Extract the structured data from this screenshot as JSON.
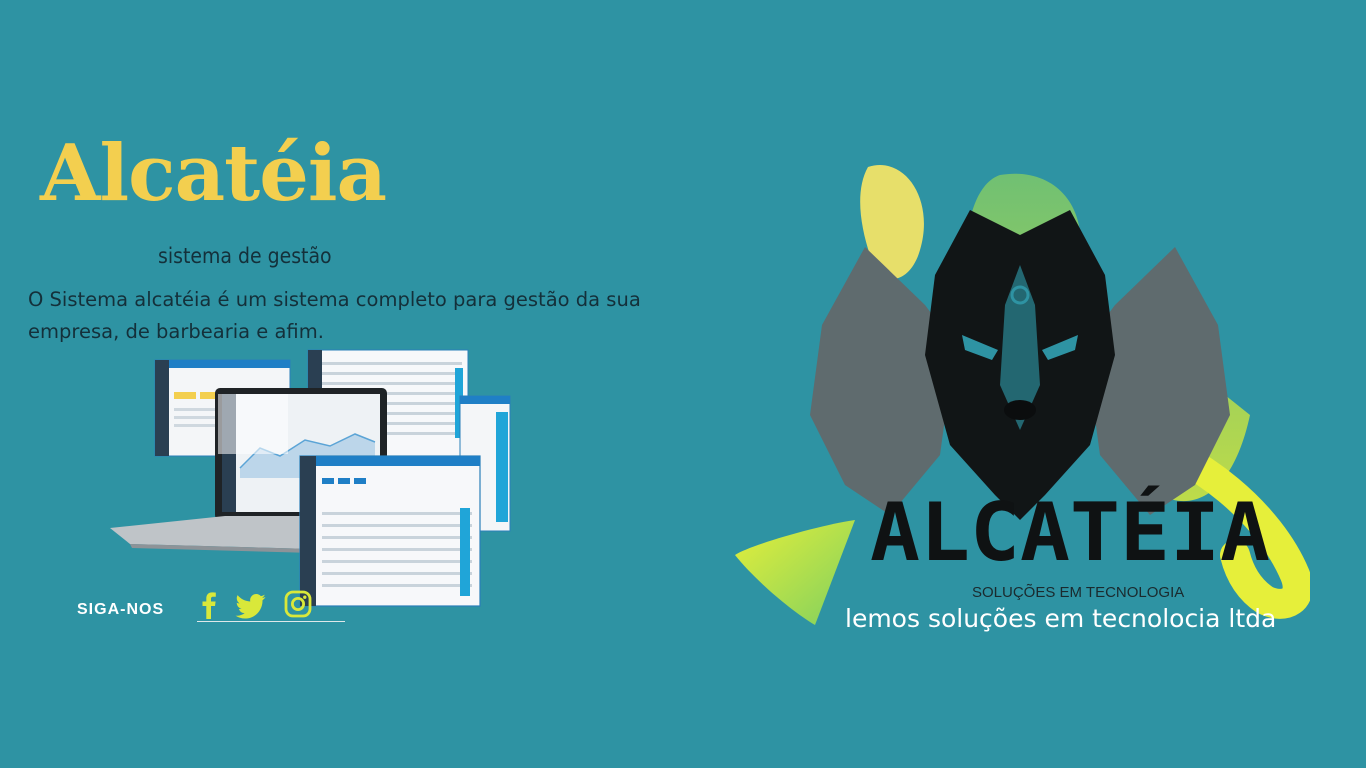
{
  "hero": {
    "title": "Alcatéia",
    "subtitle": "sistema de gestão",
    "description": "O Sistema alcatéia é um sistema completo para gestão da sua empresa,  de barbearia e afim."
  },
  "social": {
    "label": "SIGA-NOS",
    "icons": [
      "facebook-icon",
      "twitter-icon",
      "instagram-icon"
    ],
    "icon_color": "#d9e83a"
  },
  "logo": {
    "wordmark": "ALCATÉIA",
    "tagline": "SOLUÇÕES EM TECNOLOGIA",
    "company": "lemos soluções em tecnolocia ltda"
  },
  "colors": {
    "background": "#2e93a3",
    "title": "#f3cf4f",
    "accent_yellow": "#d8e83a",
    "accent_green": "#6fbf5a"
  }
}
